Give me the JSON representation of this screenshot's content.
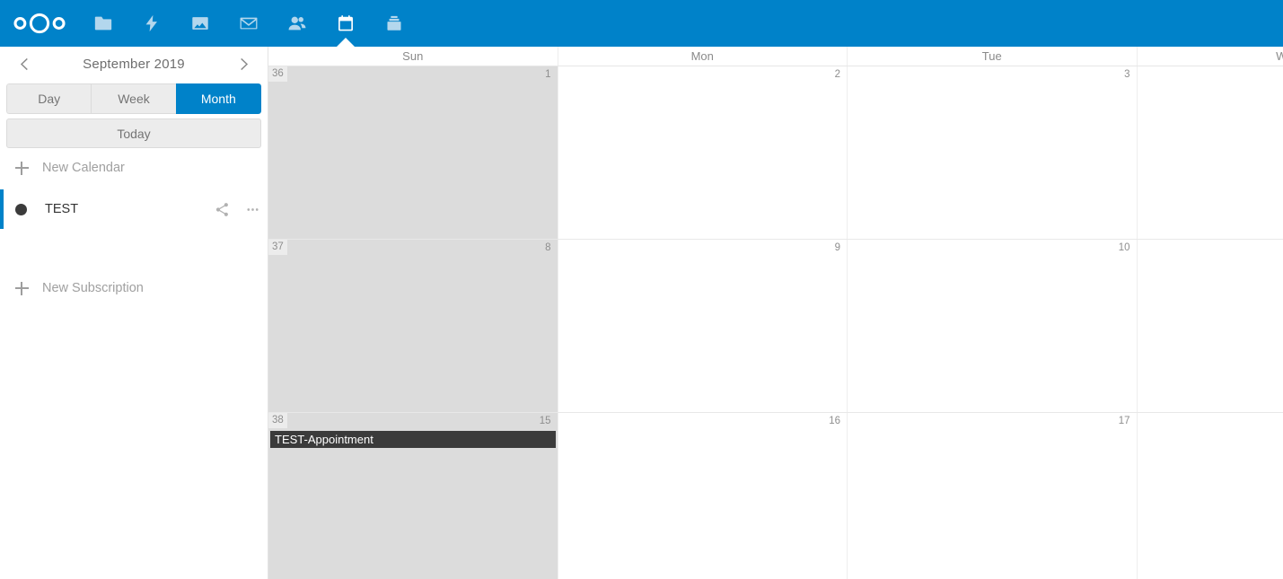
{
  "app": {
    "name": "Nextcloud Calendar",
    "accent_color": "#0082c9"
  },
  "topbar": {
    "logo_name": "nextcloud-logo",
    "apps": [
      {
        "name": "files",
        "icon": "folder-icon",
        "label": "Files",
        "active": false
      },
      {
        "name": "activity",
        "icon": "lightning-icon",
        "label": "Activity",
        "active": false
      },
      {
        "name": "photos",
        "icon": "image-icon",
        "label": "Photos",
        "active": false
      },
      {
        "name": "mail",
        "icon": "envelope-icon",
        "label": "Mail",
        "active": false
      },
      {
        "name": "contacts",
        "icon": "people-icon",
        "label": "Contacts",
        "active": false
      },
      {
        "name": "calendar",
        "icon": "calendar-icon",
        "label": "Calendar",
        "active": true
      },
      {
        "name": "deck",
        "icon": "deck-icon",
        "label": "Deck",
        "active": false
      }
    ]
  },
  "sidebar": {
    "datepicker": {
      "label": "September 2019",
      "prev_icon": "chevron-left-icon",
      "next_icon": "chevron-right-icon"
    },
    "views": [
      {
        "label": "Day",
        "active": false
      },
      {
        "label": "Week",
        "active": false
      },
      {
        "label": "Month",
        "active": true
      }
    ],
    "today_label": "Today",
    "new_calendar_label": "New Calendar",
    "new_subscription_label": "New Subscription",
    "calendars": [
      {
        "name": "TEST",
        "color": "#3b3b3b",
        "selected": true,
        "share_icon": "share-icon",
        "menu_icon": "more-dots-icon"
      }
    ]
  },
  "calendar_grid": {
    "day_headers": [
      "Sun",
      "Mon",
      "Tue",
      "W"
    ],
    "weeks": [
      {
        "week_number": "36",
        "days": [
          {
            "num": "1",
            "weekend": true,
            "events": []
          },
          {
            "num": "2",
            "weekend": false,
            "events": []
          },
          {
            "num": "3",
            "weekend": false,
            "events": []
          },
          {
            "num": "",
            "weekend": false,
            "events": []
          }
        ]
      },
      {
        "week_number": "37",
        "days": [
          {
            "num": "8",
            "weekend": true,
            "events": []
          },
          {
            "num": "9",
            "weekend": false,
            "events": []
          },
          {
            "num": "10",
            "weekend": false,
            "events": []
          },
          {
            "num": "",
            "weekend": false,
            "events": []
          }
        ]
      },
      {
        "week_number": "38",
        "days": [
          {
            "num": "15",
            "weekend": true,
            "events": [
              {
                "title": "TEST-Appointment",
                "color": "#3b3b3b"
              }
            ]
          },
          {
            "num": "16",
            "weekend": false,
            "events": []
          },
          {
            "num": "17",
            "weekend": false,
            "events": []
          },
          {
            "num": "",
            "weekend": false,
            "events": []
          }
        ]
      }
    ]
  }
}
